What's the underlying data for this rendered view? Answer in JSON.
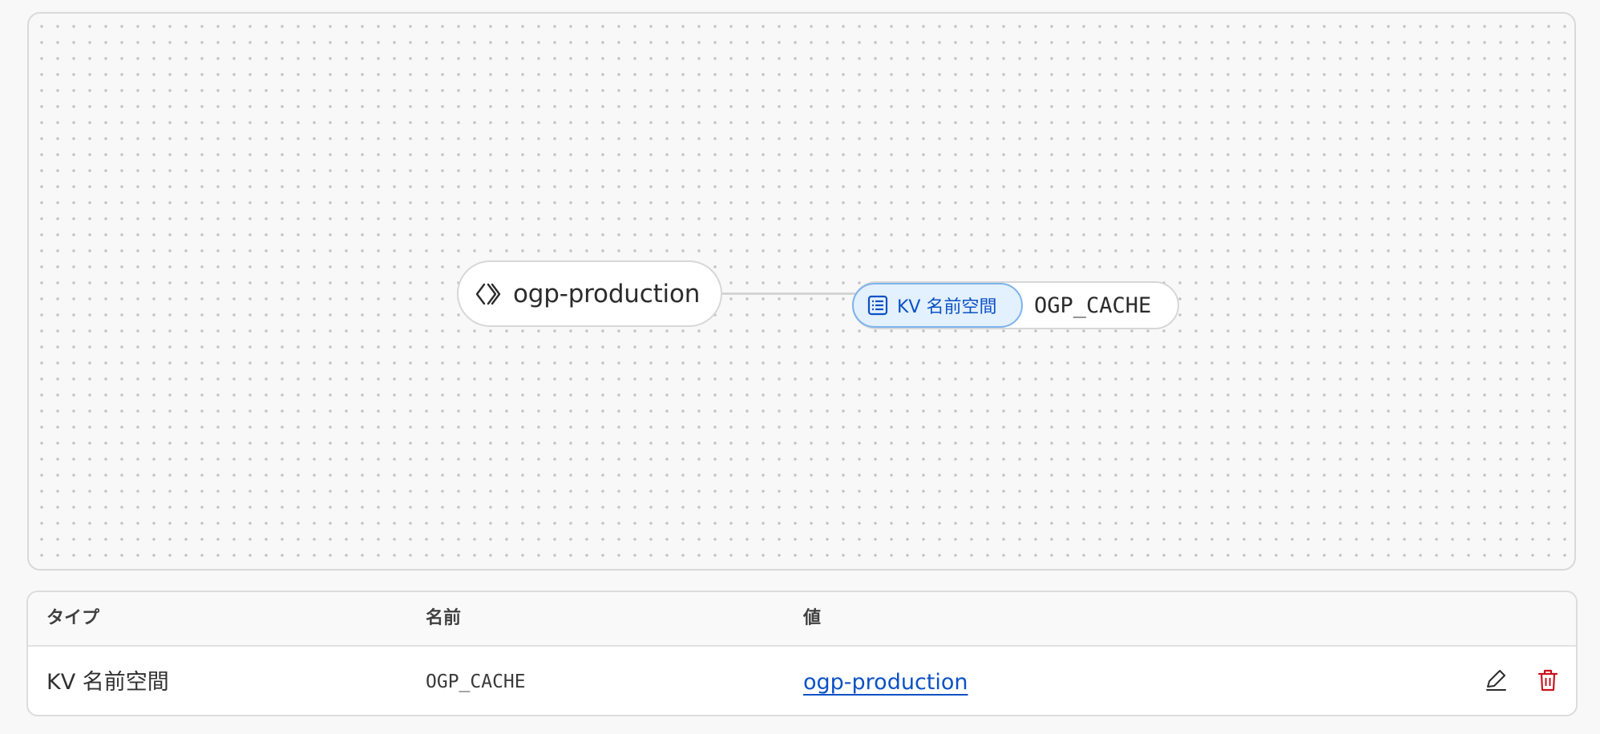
{
  "graph": {
    "worker": {
      "name": "ogp-production",
      "icon": "code-brackets-icon"
    },
    "binding": {
      "type_label": "KV 名前空間",
      "name": "OGP_CACHE",
      "icon": "list-icon",
      "accent": "#0b51c5"
    }
  },
  "table": {
    "headers": [
      "タイプ",
      "名前",
      "値"
    ],
    "rows": [
      {
        "type": "KV 名前空間",
        "name": "OGP_CACHE",
        "value": "ogp-production",
        "actions": [
          "edit-icon",
          "trash-icon"
        ]
      }
    ]
  },
  "colors": {
    "link": "#0b51c5",
    "delete": "#c9111d",
    "pill_bg": "#e3f0fd",
    "pill_border": "#7cb3ec"
  }
}
